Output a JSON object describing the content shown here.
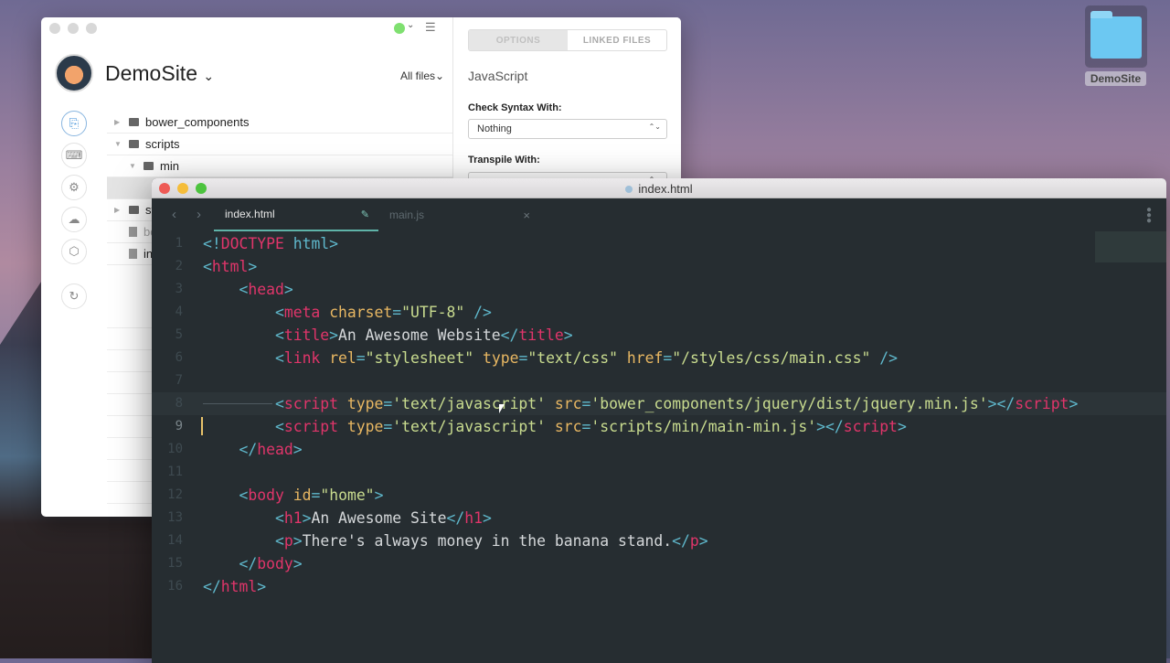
{
  "desktop": {
    "folder_label": "DemoSite"
  },
  "app": {
    "site_name": "DemoSite",
    "site_dropdown": "⌄",
    "filter": "All files⌄",
    "sidebar_icons": [
      "files-icon",
      "terminal-icon",
      "gear-icon",
      "cloud-icon",
      "package-icon",
      "sync-icon"
    ],
    "tree": [
      {
        "name": "bower_components",
        "type": "folder",
        "expanded": false,
        "depth": 0
      },
      {
        "name": "scripts",
        "type": "folder",
        "expanded": true,
        "depth": 0
      },
      {
        "name": "min",
        "type": "folder",
        "expanded": true,
        "depth": 1
      },
      {
        "name": "",
        "type": "file",
        "depth": 2,
        "selected": true
      },
      {
        "name": "st",
        "type": "folder",
        "expanded": false,
        "depth": 0
      },
      {
        "name": "bo",
        "type": "file",
        "depth": 0,
        "dim": true
      },
      {
        "name": "in",
        "type": "file",
        "depth": 0
      }
    ],
    "panel": {
      "tabs": [
        "OPTIONS",
        "LINKED FILES"
      ],
      "active_tab": "OPTIONS",
      "section": "JavaScript",
      "check_syntax_label": "Check Syntax With:",
      "check_syntax_value": "Nothing",
      "transpile_label": "Transpile With:"
    }
  },
  "editor": {
    "window_title": "index.html",
    "tabs": [
      {
        "label": "index.html",
        "active": true,
        "modified": true
      },
      {
        "label": "main.js",
        "active": false
      }
    ],
    "lines": [
      [
        [
          "b",
          "<!"
        ],
        [
          "t",
          "DOCTYPE"
        ],
        [
          "x",
          " "
        ],
        [
          "b",
          "html>"
        ]
      ],
      [
        [
          "b",
          "<"
        ],
        [
          "t",
          "html"
        ],
        [
          "b",
          ">"
        ]
      ],
      [
        [
          "x",
          "    "
        ],
        [
          "b",
          "<"
        ],
        [
          "t",
          "head"
        ],
        [
          "b",
          ">"
        ]
      ],
      [
        [
          "x",
          "        "
        ],
        [
          "b",
          "<"
        ],
        [
          "t",
          "meta"
        ],
        [
          "x",
          " "
        ],
        [
          "a",
          "charset"
        ],
        [
          "e",
          "="
        ],
        [
          "s",
          "\"UTF-8\""
        ],
        [
          "x",
          " "
        ],
        [
          "b",
          "/>"
        ]
      ],
      [
        [
          "x",
          "        "
        ],
        [
          "b",
          "<"
        ],
        [
          "t",
          "title"
        ],
        [
          "b",
          ">"
        ],
        [
          "x",
          "An Awesome Website"
        ],
        [
          "b",
          "</"
        ],
        [
          "t",
          "title"
        ],
        [
          "b",
          ">"
        ]
      ],
      [
        [
          "x",
          "        "
        ],
        [
          "b",
          "<"
        ],
        [
          "t",
          "link"
        ],
        [
          "x",
          " "
        ],
        [
          "a",
          "rel"
        ],
        [
          "e",
          "="
        ],
        [
          "s",
          "\"stylesheet\""
        ],
        [
          "x",
          " "
        ],
        [
          "a",
          "type"
        ],
        [
          "e",
          "="
        ],
        [
          "s",
          "\"text/css\""
        ],
        [
          "x",
          " "
        ],
        [
          "a",
          "href"
        ],
        [
          "e",
          "="
        ],
        [
          "s",
          "\"/styles/css/main.css\""
        ],
        [
          "x",
          " "
        ],
        [
          "b",
          "/>"
        ]
      ],
      [],
      [
        [
          "x",
          "        "
        ],
        [
          "b",
          "<"
        ],
        [
          "t",
          "script"
        ],
        [
          "x",
          " "
        ],
        [
          "a",
          "type"
        ],
        [
          "e",
          "="
        ],
        [
          "s",
          "'text/javascript'"
        ],
        [
          "x",
          " "
        ],
        [
          "a",
          "src"
        ],
        [
          "e",
          "="
        ],
        [
          "s",
          "'bower_components/jquery/dist/jquery.min.js'"
        ],
        [
          "b",
          "></"
        ],
        [
          "t",
          "script"
        ],
        [
          "b",
          ">"
        ]
      ],
      [
        [
          "x",
          "        "
        ],
        [
          "b",
          "<"
        ],
        [
          "t",
          "script"
        ],
        [
          "x",
          " "
        ],
        [
          "a",
          "type"
        ],
        [
          "e",
          "="
        ],
        [
          "s",
          "'text/javascript'"
        ],
        [
          "x",
          " "
        ],
        [
          "a",
          "src"
        ],
        [
          "e",
          "="
        ],
        [
          "s",
          "'scripts/min/main-min.js'"
        ],
        [
          "b",
          "></"
        ],
        [
          "t",
          "script"
        ],
        [
          "b",
          ">"
        ]
      ],
      [
        [
          "x",
          "    "
        ],
        [
          "b",
          "</"
        ],
        [
          "t",
          "head"
        ],
        [
          "b",
          ">"
        ]
      ],
      [],
      [
        [
          "x",
          "    "
        ],
        [
          "b",
          "<"
        ],
        [
          "t",
          "body"
        ],
        [
          "x",
          " "
        ],
        [
          "a",
          "id"
        ],
        [
          "e",
          "="
        ],
        [
          "s",
          "\"home\""
        ],
        [
          "b",
          ">"
        ]
      ],
      [
        [
          "x",
          "        "
        ],
        [
          "b",
          "<"
        ],
        [
          "t",
          "h1"
        ],
        [
          "b",
          ">"
        ],
        [
          "x",
          "An Awesome Site"
        ],
        [
          "b",
          "</"
        ],
        [
          "t",
          "h1"
        ],
        [
          "b",
          ">"
        ]
      ],
      [
        [
          "x",
          "        "
        ],
        [
          "b",
          "<"
        ],
        [
          "t",
          "p"
        ],
        [
          "b",
          ">"
        ],
        [
          "x",
          "There's always money in the banana stand."
        ],
        [
          "b",
          "</"
        ],
        [
          "t",
          "p"
        ],
        [
          "b",
          ">"
        ]
      ],
      [
        [
          "x",
          "    "
        ],
        [
          "b",
          "</"
        ],
        [
          "t",
          "body"
        ],
        [
          "b",
          ">"
        ]
      ],
      [
        [
          "b",
          "</"
        ],
        [
          "t",
          "html"
        ],
        [
          "b",
          ">"
        ]
      ]
    ],
    "highlight_line": 8,
    "cursor_line": 9
  }
}
